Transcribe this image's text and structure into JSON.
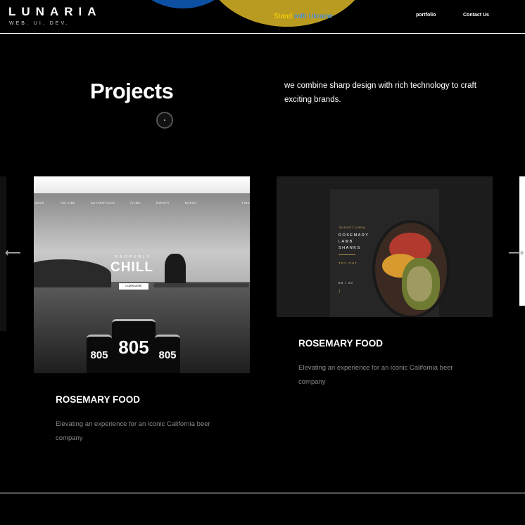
{
  "header": {
    "logo": "LUNARIA",
    "logo_sub": "WEB. UI. DEV.",
    "stand_part1": "Stand",
    "stand_part2": " with Ukraine",
    "nav": [
      "portfolio",
      "Contact Us"
    ],
    "colors": {
      "blue": "#0d4fa3",
      "yellow": "#ba9b22"
    }
  },
  "hero": {
    "title": "Projects",
    "description": "we combine sharp design with rich technology to craft exciting brands."
  },
  "slider": {
    "prev_icon": "arrow-left-icon",
    "next_icon": "arrow-right-icon",
    "cards": [
      {
        "title": "ROSEMARY FOOD",
        "description": "Elevating an experience for an iconic California beer company",
        "image": {
          "nav": [
            "BEER",
            "THE VIBE",
            "AUTHENTICOS",
            "FILMS",
            "EVENTS",
            "MERCH",
            "FIND"
          ],
          "kicker": "PROPERLY",
          "headline": "CHILL",
          "button": "LEARN MORE",
          "can_label": "805"
        }
      },
      {
        "title": "ROSEMARY FOOD",
        "description": "Elevating an experience for an iconic California beer company",
        "image": {
          "small": "Assisted Cooking",
          "title_lines": [
            "ROSEMARY",
            "LAMB",
            "SHANKS"
          ],
          "cta": "TRY OUT",
          "page": "03 / 10"
        }
      }
    ]
  }
}
